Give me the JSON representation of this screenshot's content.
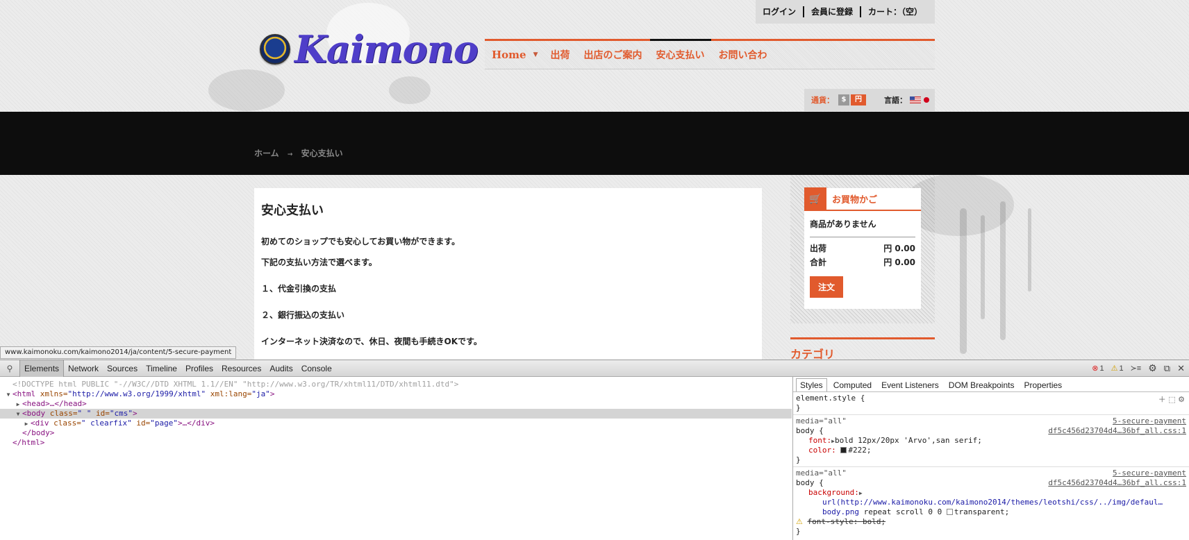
{
  "header": {
    "top_links": [
      "ログイン",
      "会員に登録",
      "カート：（空）"
    ],
    "logo_text": "Kaimono",
    "nav": {
      "home": "Home",
      "items": [
        "出荷",
        "出店のご案内",
        "安心支払い",
        "お問い合わ"
      ]
    },
    "currency_label": "通貨：",
    "currency_options": [
      "$",
      "円"
    ],
    "language_label": "言語："
  },
  "breadcrumb": {
    "home": "ホーム",
    "current": "安心支払い"
  },
  "content": {
    "title": "安心支払い",
    "para1": "初めてのショップでも安心してお買い物ができます。",
    "para2": "下記の支払い方法で選べます。",
    "item1": "１、代金引換の支払",
    "item2": "２、銀行振込の支払い",
    "item3": "インターネット決済なので、休日、夜間も手続きOKです。"
  },
  "cart": {
    "title": "お買物かご",
    "empty": "商品がありません",
    "shipping_label": "出荷",
    "shipping_value": "円 0.00",
    "total_label": "合計",
    "total_value": "円 0.00",
    "order_button": "注文"
  },
  "category_heading": "カテゴリ",
  "status_url": "www.kaimonoku.com/kaimono2014/ja/content/5-secure-payment",
  "devtools": {
    "tabs": [
      "Elements",
      "Network",
      "Sources",
      "Timeline",
      "Profiles",
      "Resources",
      "Audits",
      "Console"
    ],
    "error_count": "1",
    "warning_count": "1",
    "dom": {
      "doctype": "<!DOCTYPE html PUBLIC \"-//W3C//DTD XHTML 1.1//EN\" \"http://www.w3.org/TR/xhtml11/DTD/xhtml11.dtd\">",
      "html_open_tag": "html",
      "html_xmlns_attr": " xmlns=",
      "html_xmlns_val": "\"http://www.w3.org/1999/xhtml\"",
      "html_lang_attr": " xml:lang=",
      "html_lang_val": "\"ja\"",
      "head": "<head>…</head>",
      "body_tag": "body",
      "body_class_attr": " class=",
      "body_class_val": "\" \"",
      "body_id_attr": " id=",
      "body_id_val": "\"cms\"",
      "div_tag": "div",
      "div_class_attr": " class=",
      "div_class_val": "\"  clearfix\"",
      "div_id_attr": " id=",
      "div_id_val": "\"page\"",
      "div_rest": ">…</div>",
      "body_close": "</body>",
      "html_close": "</html>"
    },
    "styles_tabs": [
      "Styles",
      "Computed",
      "Event Listeners",
      "DOM Breakpoints",
      "Properties"
    ],
    "element_style": "element.style {",
    "rule1": {
      "media": "media=\"all\"",
      "source_page": "5-secure-payment",
      "source_file": "df5c456d23704d4…36bf_all.css:1",
      "selector": "body {",
      "font_prop": "font:",
      "font_val": "bold 12px/20px 'Arvo',san serif;",
      "color_prop": "color:",
      "color_val": "#222;"
    },
    "rule2": {
      "media": "media=\"all\"",
      "source_page": "5-secure-payment",
      "source_file": "df5c456d23704d4…36bf_all.css:1",
      "selector": "body {",
      "bg_prop": "background:",
      "bg_url": "url(http://www.kaimonoku.com/kaimono2014/themes/leotshi/css/../img/defaul…",
      "bg_url2": "body.png",
      "bg_rest": " repeat scroll 0 0 ",
      "bg_end": "transparent;",
      "font_style": "font-style: bold;"
    },
    "close_brace": "}"
  },
  "colors": {
    "accent": "#e15a2d",
    "logo": "#4f3ec9",
    "band": "#0d0d0d"
  }
}
